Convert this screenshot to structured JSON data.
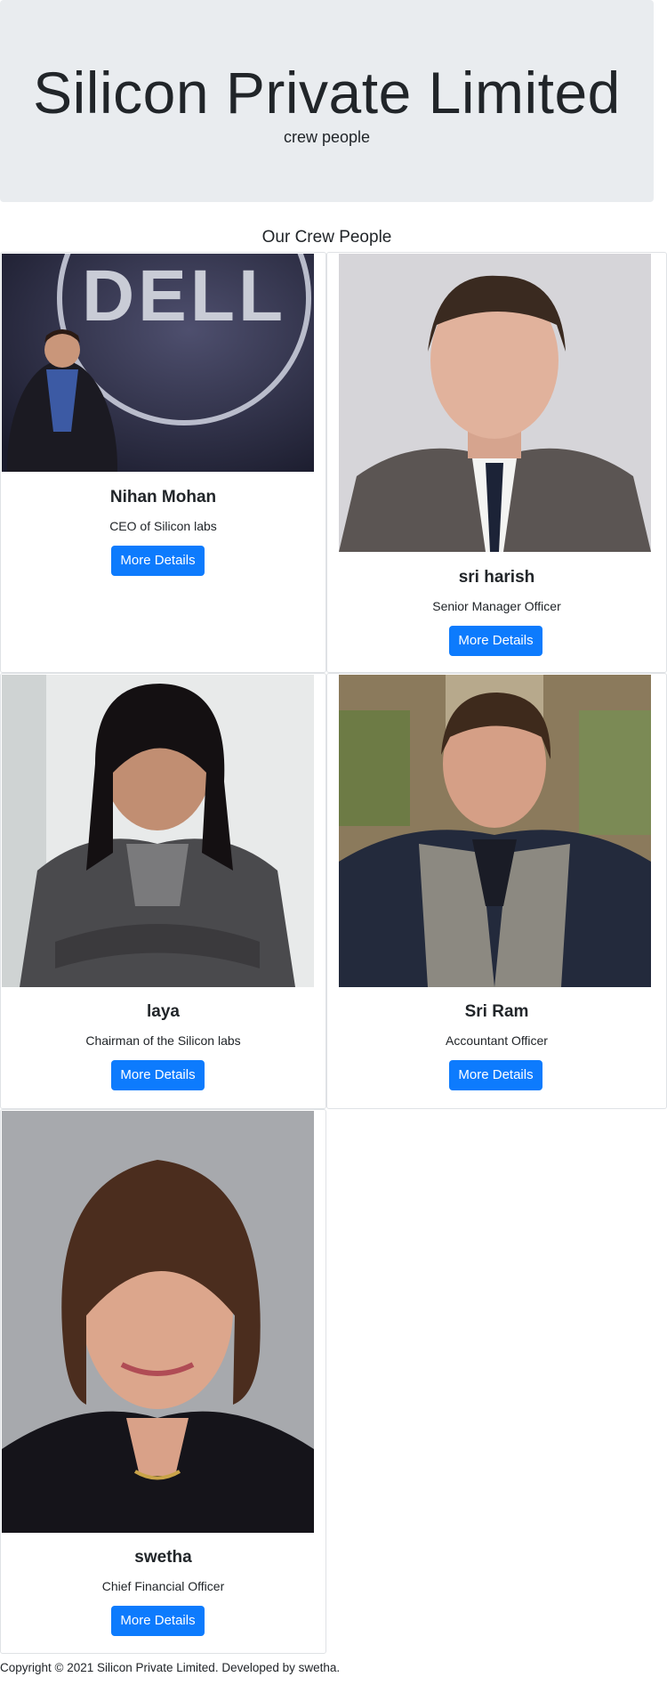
{
  "header": {
    "title": "Silicon Private Limited",
    "subtitle": "crew people"
  },
  "section": {
    "title": "Our Crew People"
  },
  "crew": [
    {
      "name": "Nihan Mohan",
      "role": "CEO of Silicon labs",
      "button": "More Details",
      "photo": "man-on-stage-dell-logo"
    },
    {
      "name": "sri harish",
      "role": "Senior Manager Officer",
      "button": "More Details",
      "photo": "man-in-suit-portrait"
    },
    {
      "name": "laya",
      "role": "Chairman of the Silicon labs",
      "button": "More Details",
      "photo": "woman-arms-crossed-portrait"
    },
    {
      "name": "Sri Ram",
      "role": "Accountant Officer",
      "button": "More Details",
      "photo": "man-in-vest-portrait"
    },
    {
      "name": "swetha",
      "role": "Chief Financial Officer",
      "button": "More Details",
      "photo": "woman-in-black-blazer-portrait"
    }
  ],
  "footer": {
    "text": "Copyright © 2021 Silicon Private Limited. Developed by swetha."
  },
  "colors": {
    "jumbotron_bg": "#e9ecef",
    "button_primary": "#0d7bfd",
    "card_border": "#dfe2e5"
  }
}
